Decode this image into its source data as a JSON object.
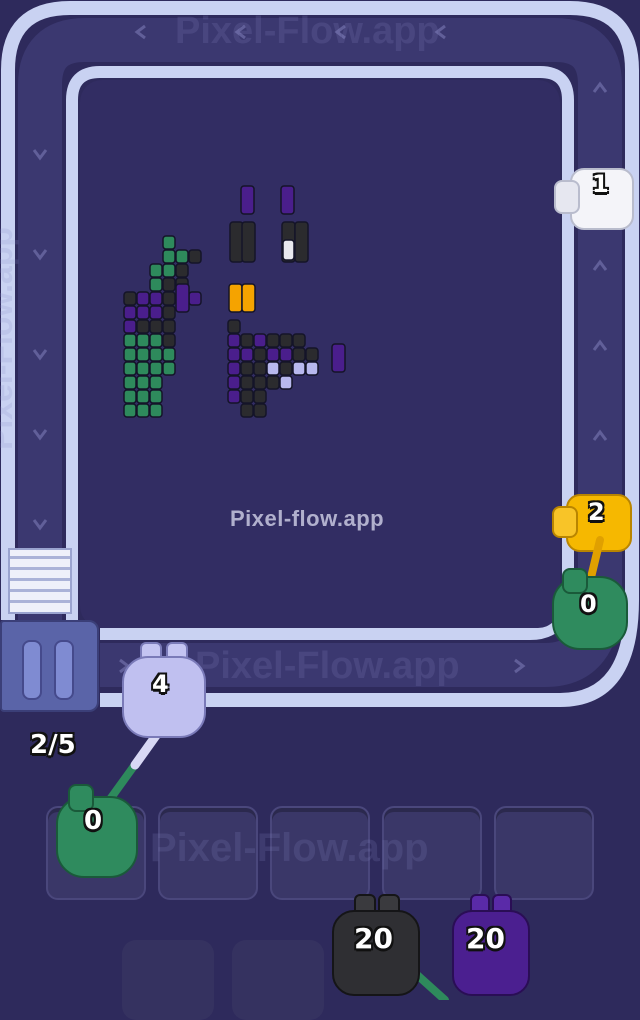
{
  "watermark": "Pixel-flow.app",
  "conveyor": {
    "watermark_top": "Pixel-Flow.app",
    "watermark_bottom": "Pixel-Flow.app",
    "watermark_side": "Pixel-Flow.app",
    "slot_watermark": "Pixel-Flow.app",
    "track_color": "#9aa8d8",
    "queue_counter": "2/5"
  },
  "shooters_on_track": [
    {
      "name": "white-shooter",
      "color": "#f2f2f7",
      "ammo": "1"
    },
    {
      "name": "yellow-shooter",
      "color": "#f5b800",
      "ammo": "2"
    },
    {
      "name": "green-shooter",
      "color": "#2e8a5c",
      "ammo": "0"
    },
    {
      "name": "lavender-shooter",
      "color": "#b8b8ee",
      "ammo": "4"
    }
  ],
  "holding_slots": {
    "first_slot": {
      "color": "#2e8a5c",
      "ammo": "0"
    },
    "empty_count": "4"
  },
  "waiting_queue": [
    {
      "name": "black-shooter",
      "color": "#2b2b2e",
      "ammo": "20"
    },
    {
      "name": "purple-shooter",
      "color": "#4a1e8c",
      "ammo": "20"
    }
  ],
  "palette": {
    "green": "#2e8a5c",
    "purple": "#4a1e8c",
    "black": "#2b2b2e",
    "lavender": "#b8b8ee",
    "orange": "#f5a300",
    "white": "#e8e8ee"
  }
}
